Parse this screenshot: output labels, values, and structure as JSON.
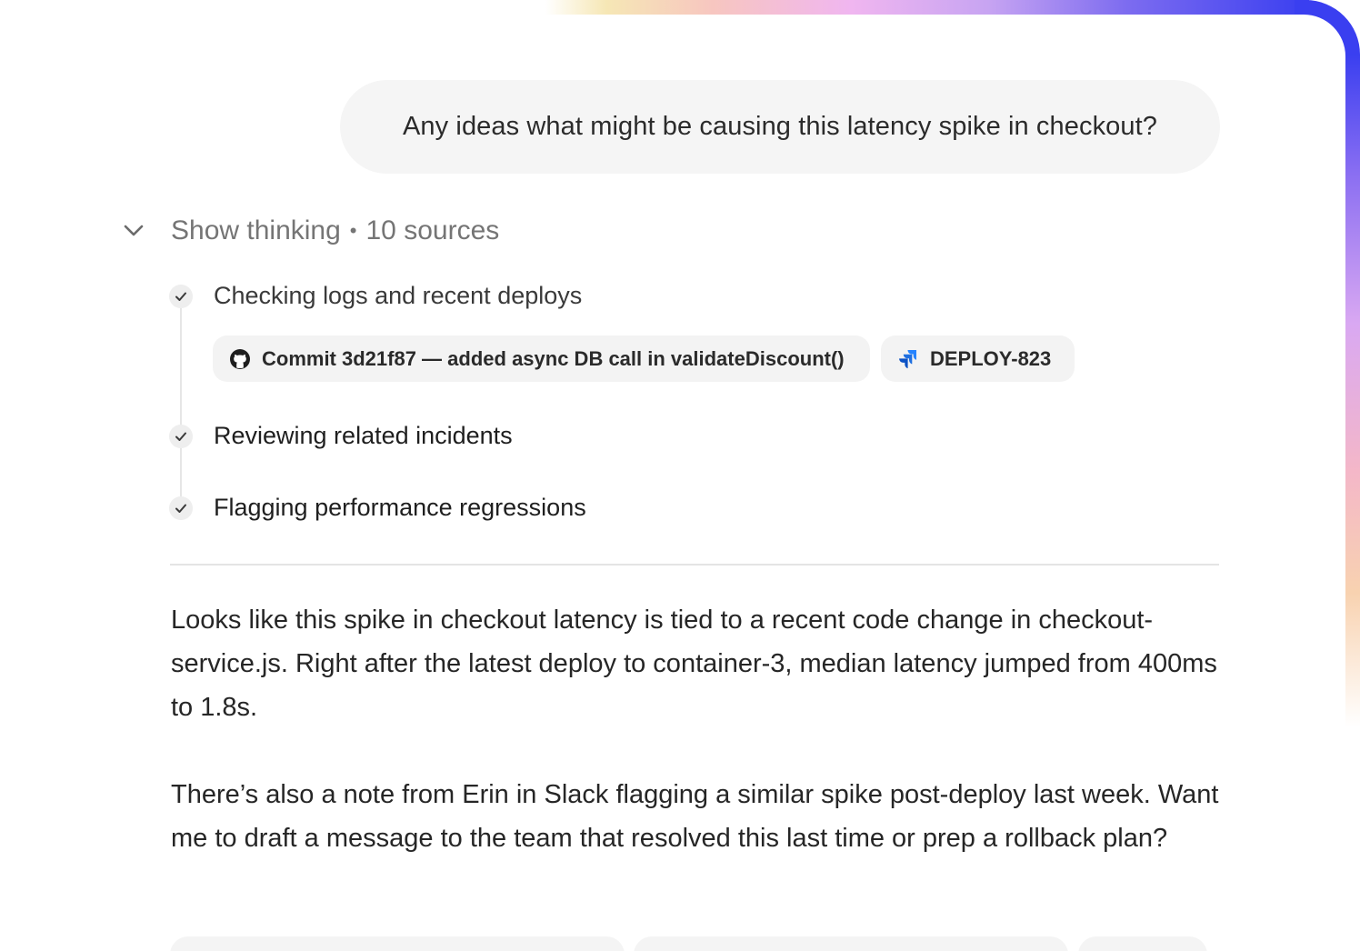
{
  "user_message": {
    "text": "Any ideas what might be causing this latency spike in checkout?"
  },
  "thinking": {
    "toggle_label": "Show thinking",
    "separator": "•",
    "sources_label": "10 sources",
    "steps": [
      {
        "label": "Checking logs and recent deploys"
      },
      {
        "label": "Reviewing related incidents"
      },
      {
        "label": "Flagging performance regressions"
      }
    ],
    "sources": [
      {
        "icon": "github-icon",
        "label": "Commit 3d21f87 — added async DB call in validateDiscount()"
      },
      {
        "icon": "jira-icon",
        "label": "DEPLOY-823"
      }
    ]
  },
  "answer": {
    "paragraphs": [
      "Looks like this spike in checkout latency is tied to a recent code change in checkout-service.js. Right after the latest deploy to container-3, median latency jumped from 400ms to 1.8s.",
      "There’s also a note from Erin in Slack flagging a similar spike post-deploy last week. Want me to draft a message to the team that resolved this last time or prep a rollback plan?"
    ]
  },
  "colors": {
    "bubble_bg": "#f5f5f5",
    "chip_bg": "#f3f3f3",
    "muted_text": "#757575",
    "frame_blue": "#3a3ff0",
    "jira_blue": "#2684ff"
  }
}
